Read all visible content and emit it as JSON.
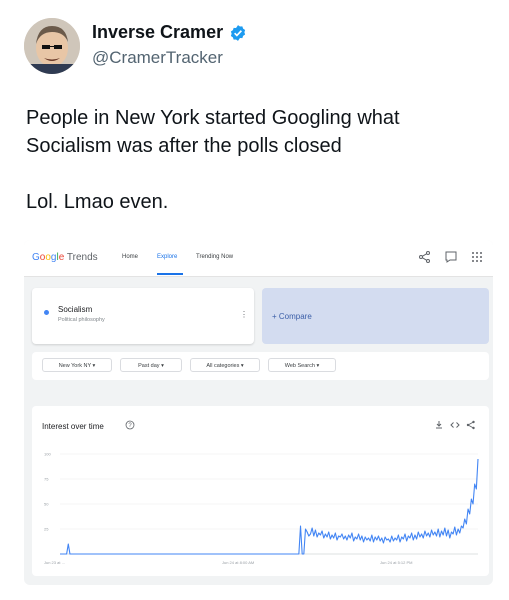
{
  "tweet": {
    "author_name": "Inverse Cramer",
    "handle": "@CramerTracker",
    "text_line1": "People in New York started Googling what",
    "text_line2": "Socialism was after the polls closed",
    "text_line3": "Lol. Lmao even."
  },
  "trends": {
    "logo_google": "Google",
    "logo_trends": "Trends",
    "nav": {
      "home": "Home",
      "explore": "Explore",
      "trending": "Trending Now"
    },
    "term": {
      "name": "Socialism",
      "subtitle": "Political philosophy",
      "menu": "⋮"
    },
    "compare_label": "+ Compare",
    "filters": {
      "region": "New York NY ▾",
      "period": "Past day ▾",
      "category": "All categories ▾",
      "search_type": "Web Search ▾"
    },
    "chart_title": "Interest over time"
  },
  "chart_data": {
    "type": "line",
    "title": "Interest over time",
    "ylim": [
      0,
      100
    ],
    "y_ticks": [
      "100",
      "75",
      "50",
      "25"
    ],
    "x_ticks": [
      "Jun 23 at ...",
      "Jun 24 at 8:00 AM",
      "Jun 24 at 5:12 PM"
    ],
    "series": [
      {
        "color": "#4285f4",
        "values": [
          0,
          0,
          0,
          0,
          0,
          10,
          0,
          0,
          0,
          0,
          0,
          0,
          0,
          0,
          0,
          0,
          0,
          0,
          0,
          0,
          0,
          0,
          0,
          0,
          0,
          0,
          0,
          0,
          0,
          0,
          0,
          0,
          0,
          0,
          0,
          0,
          0,
          0,
          0,
          0,
          0,
          0,
          0,
          0,
          0,
          0,
          0,
          0,
          0,
          0,
          0,
          0,
          0,
          0,
          0,
          0,
          0,
          0,
          0,
          0,
          0,
          0,
          0,
          0,
          0,
          0,
          0,
          0,
          0,
          0,
          0,
          0,
          0,
          0,
          0,
          0,
          0,
          0,
          0,
          0,
          0,
          0,
          0,
          0,
          0,
          0,
          0,
          0,
          0,
          0,
          0,
          0,
          0,
          0,
          0,
          0,
          0,
          0,
          0,
          0,
          0,
          0,
          0,
          0,
          0,
          0,
          0,
          0,
          0,
          0,
          0,
          0,
          0,
          0,
          0,
          0,
          0,
          0,
          0,
          0,
          0,
          0,
          0,
          0,
          0,
          0,
          0,
          0,
          0,
          0,
          0,
          0,
          0,
          0,
          0,
          0,
          0,
          0,
          0,
          0,
          0,
          0,
          0,
          0,
          0,
          28,
          0,
          0,
          25,
          22,
          18,
          20,
          26,
          18,
          24,
          17,
          21,
          19,
          23,
          16,
          20,
          17,
          22,
          15,
          19,
          16,
          21,
          14,
          18,
          17,
          20,
          15,
          18,
          14,
          19,
          16,
          21,
          13,
          17,
          15,
          20,
          14,
          18,
          12,
          17,
          14,
          16,
          13,
          19,
          12,
          17,
          14,
          18,
          13,
          16,
          11,
          17,
          14,
          15,
          12,
          18,
          13,
          16,
          14,
          19,
          12,
          17,
          15,
          20,
          13,
          18,
          16,
          21,
          14,
          19,
          15,
          22,
          17,
          20,
          16,
          23,
          18,
          21,
          17,
          24,
          19,
          22,
          18,
          25,
          17,
          23,
          19,
          26,
          18,
          24,
          16,
          22,
          20,
          27,
          19,
          25,
          21,
          28,
          26,
          35,
          30,
          45,
          40,
          55,
          50,
          70,
          65,
          95
        ]
      }
    ]
  }
}
